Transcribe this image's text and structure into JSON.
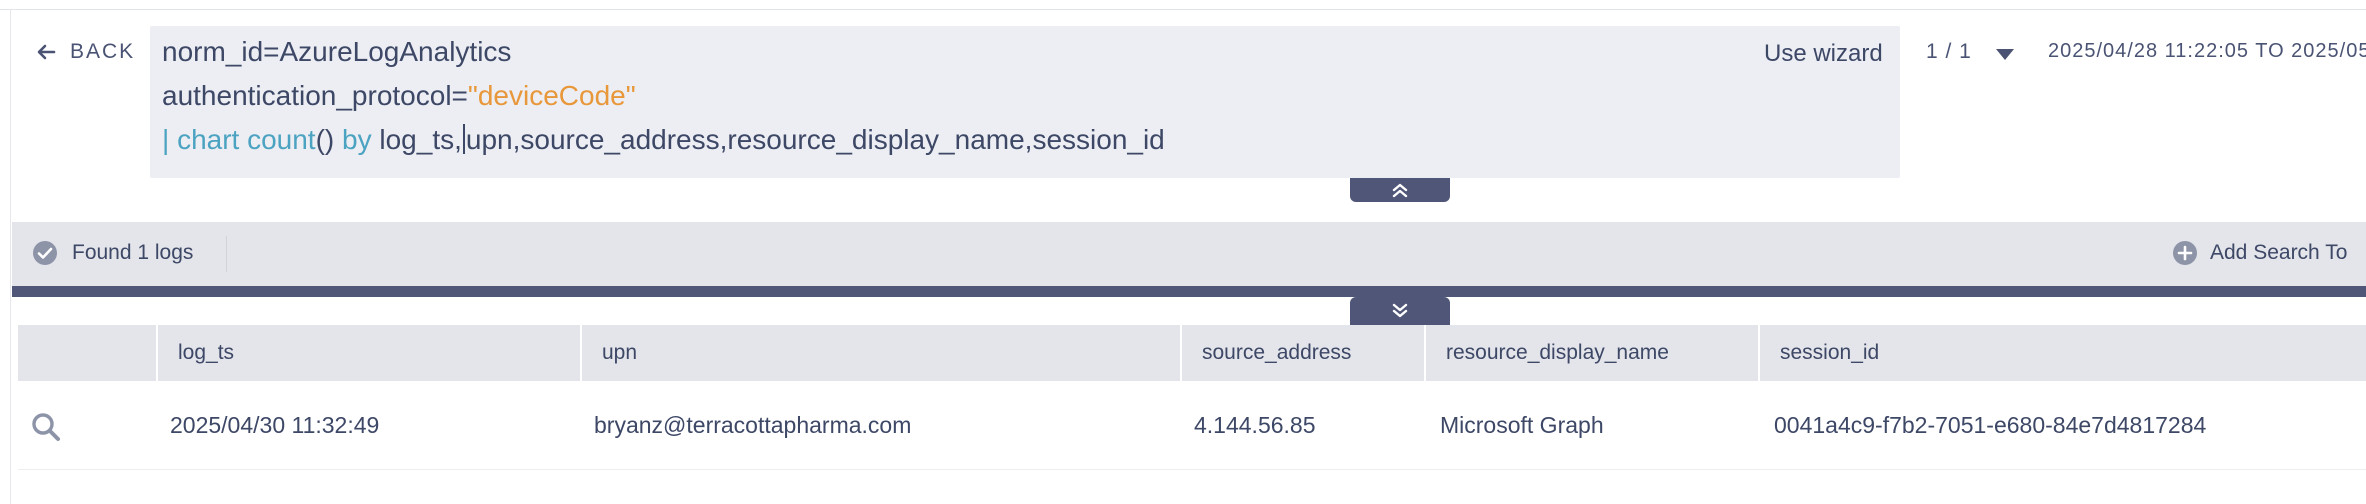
{
  "nav": {
    "back_label": "BACK"
  },
  "query": {
    "line1": "norm_id=AzureLogAnalytics",
    "line2_key": "authentication_protocol=",
    "line2_value": "\"deviceCode\"",
    "line3_pipe": "| ",
    "line3_cmd": "chart count",
    "line3_parens": "() ",
    "line3_by": "by",
    "line3_fields_a": " log_ts,",
    "line3_fields_b": "upn,source_address,resource_display_name,session_id"
  },
  "toolbar": {
    "wizard_label": "Use wizard",
    "pager": "1 / 1",
    "date_range": "2025/04/28 11:22:05 TO 2025/05"
  },
  "status": {
    "found_label": "Found 1 logs",
    "add_search_label": "Add Search To"
  },
  "table": {
    "columns": [
      "log_ts",
      "upn",
      "source_address",
      "resource_display_name",
      "session_id"
    ],
    "rows": [
      {
        "log_ts": "2025/04/30 11:32:49",
        "upn": "bryanz@terracottapharma.com",
        "source_address": "4.144.56.85",
        "resource_display_name": "Microsoft Graph",
        "session_id": "0041a4c9-f7b2-7051-e680-84e7d4817284"
      }
    ]
  },
  "colors": {
    "accent_dark": "#4f5677",
    "keyword": "#4ba3c1",
    "string": "#e8973a",
    "text": "#3d4766"
  }
}
